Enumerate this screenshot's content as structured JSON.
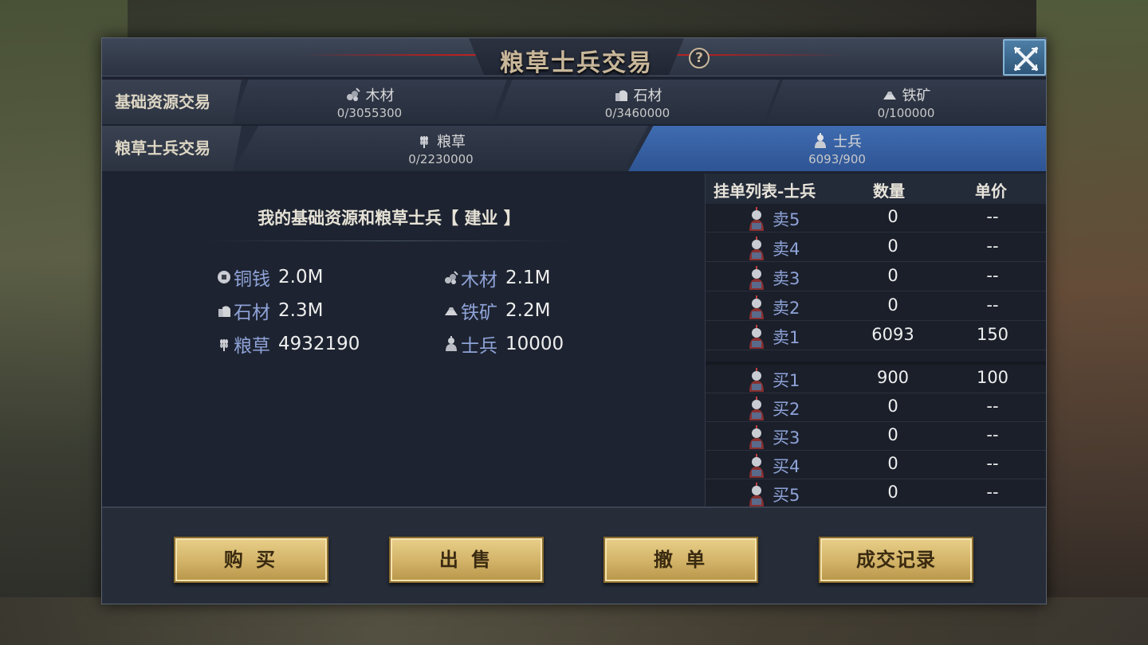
{
  "dialog": {
    "title": "粮草士兵交易",
    "help_symbol": "?"
  },
  "basic_row": {
    "label": "基础资源交易",
    "tabs": [
      {
        "name": "木材",
        "count": "0/3055300",
        "icon": "wood-icon"
      },
      {
        "name": "石材",
        "count": "0/3460000",
        "icon": "stone-icon"
      },
      {
        "name": "铁矿",
        "count": "0/100000",
        "icon": "iron-icon"
      }
    ]
  },
  "army_row": {
    "label": "粮草士兵交易",
    "tabs": [
      {
        "name": "粮草",
        "count": "0/2230000",
        "icon": "grain-icon"
      },
      {
        "name": "士兵",
        "count": "6093/900",
        "icon": "soldier-icon",
        "active": true
      }
    ]
  },
  "my_resources": {
    "heading": "我的基础资源和粮草士兵【 建业 】",
    "items": [
      {
        "label": "铜钱",
        "value": "2.0M",
        "icon": "coin-icon"
      },
      {
        "label": "木材",
        "value": "2.1M",
        "icon": "wood-icon"
      },
      {
        "label": "石材",
        "value": "2.3M",
        "icon": "stone-icon"
      },
      {
        "label": "铁矿",
        "value": "2.2M",
        "icon": "iron-icon"
      },
      {
        "label": "粮草",
        "value": "4932190",
        "icon": "grain-icon"
      },
      {
        "label": "士兵",
        "value": "10000",
        "icon": "soldier-icon"
      }
    ]
  },
  "order_book": {
    "headers": {
      "list": "挂单列表-士兵",
      "qty": "数量",
      "price": "单价"
    },
    "sell": [
      {
        "type": "卖5",
        "qty": "0",
        "price": "--"
      },
      {
        "type": "卖4",
        "qty": "0",
        "price": "--"
      },
      {
        "type": "卖3",
        "qty": "0",
        "price": "--"
      },
      {
        "type": "卖2",
        "qty": "0",
        "price": "--"
      },
      {
        "type": "卖1",
        "qty": "6093",
        "price": "150"
      }
    ],
    "buy": [
      {
        "type": "买1",
        "qty": "900",
        "price": "100"
      },
      {
        "type": "买2",
        "qty": "0",
        "price": "--"
      },
      {
        "type": "买3",
        "qty": "0",
        "price": "--"
      },
      {
        "type": "买4",
        "qty": "0",
        "price": "--"
      },
      {
        "type": "买5",
        "qty": "0",
        "price": "--"
      }
    ]
  },
  "buttons": {
    "buy": "购 买",
    "sell": "出 售",
    "cancel": "撤 单",
    "history": "成交记录"
  },
  "colors": {
    "accent_blue": "#3f6cb0",
    "gold_button": "#d4b56a",
    "label_blue": "#8fa3d8",
    "title_gold": "#c9b79a"
  }
}
